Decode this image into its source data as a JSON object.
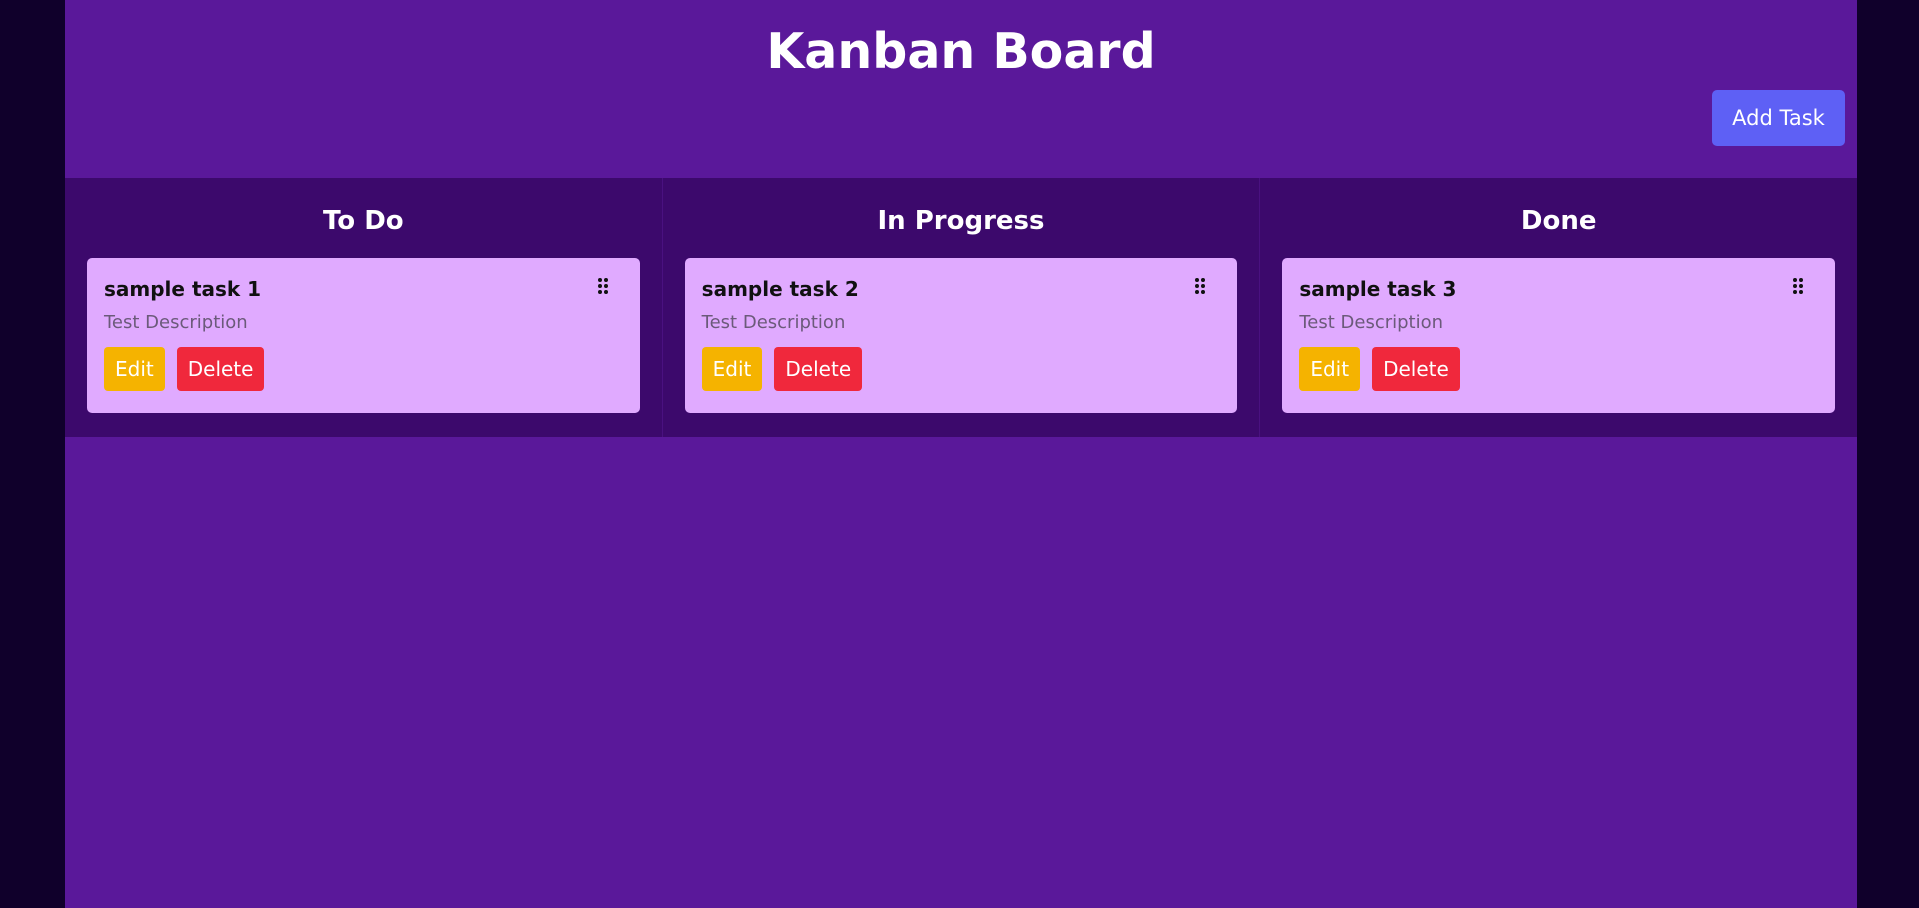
{
  "header": {
    "title": "Kanban Board",
    "add_task_label": "Add Task"
  },
  "columns": [
    {
      "title": "To Do",
      "cards": [
        {
          "title": "sample task 1",
          "description": "Test Description",
          "edit_label": "Edit",
          "delete_label": "Delete"
        }
      ]
    },
    {
      "title": "In Progress",
      "cards": [
        {
          "title": "sample task 2",
          "description": "Test Description",
          "edit_label": "Edit",
          "delete_label": "Delete"
        }
      ]
    },
    {
      "title": "Done",
      "cards": [
        {
          "title": "sample task 3",
          "description": "Test Description",
          "edit_label": "Edit",
          "delete_label": "Delete"
        }
      ]
    }
  ],
  "colors": {
    "page_background": "#10002b",
    "app_background": "#5a189a",
    "column_background": "#3c096c",
    "card_background": "#e0aaff",
    "add_button": "#5e60f5",
    "edit_button": "#f5b300",
    "delete_button": "#f0283c"
  },
  "icons": {
    "drag_handle": "drag-handle-icon"
  }
}
